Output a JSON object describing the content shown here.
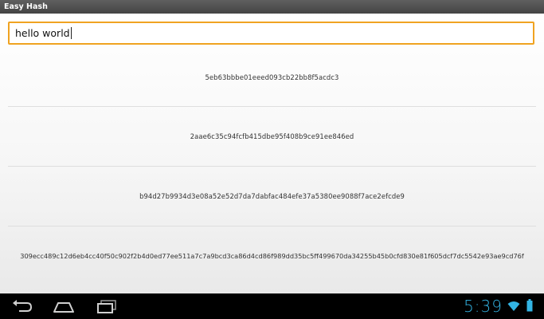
{
  "app": {
    "title": "Easy Hash"
  },
  "input": {
    "value": "hello world"
  },
  "hashes": [
    "5eb63bbbe01eeed093cb22bb8f5acdc3",
    "2aae6c35c94fcfb415dbe95f408b9ce91ee846ed",
    "b94d27b9934d3e08a52e52d7da7dabfac484efe37a5380ee9088f7ace2efcde9",
    "309ecc489c12d6eb4cc40f50c902f2b4d0ed77ee511a7c7a9bcd3ca86d4cd86f989dd35bc5ff499670da34255b45b0cfd830e81f605dcf7dc5542e93ae9cd76f"
  ],
  "navbar": {
    "buttons": [
      "back",
      "home",
      "recent-apps"
    ],
    "icon_color": "#cfcfcf"
  },
  "status": {
    "time": "5:39",
    "accent_color": "#33b5e5",
    "icons": [
      "wifi-icon",
      "battery-icon"
    ]
  },
  "colors": {
    "input_border": "#f0a321"
  }
}
